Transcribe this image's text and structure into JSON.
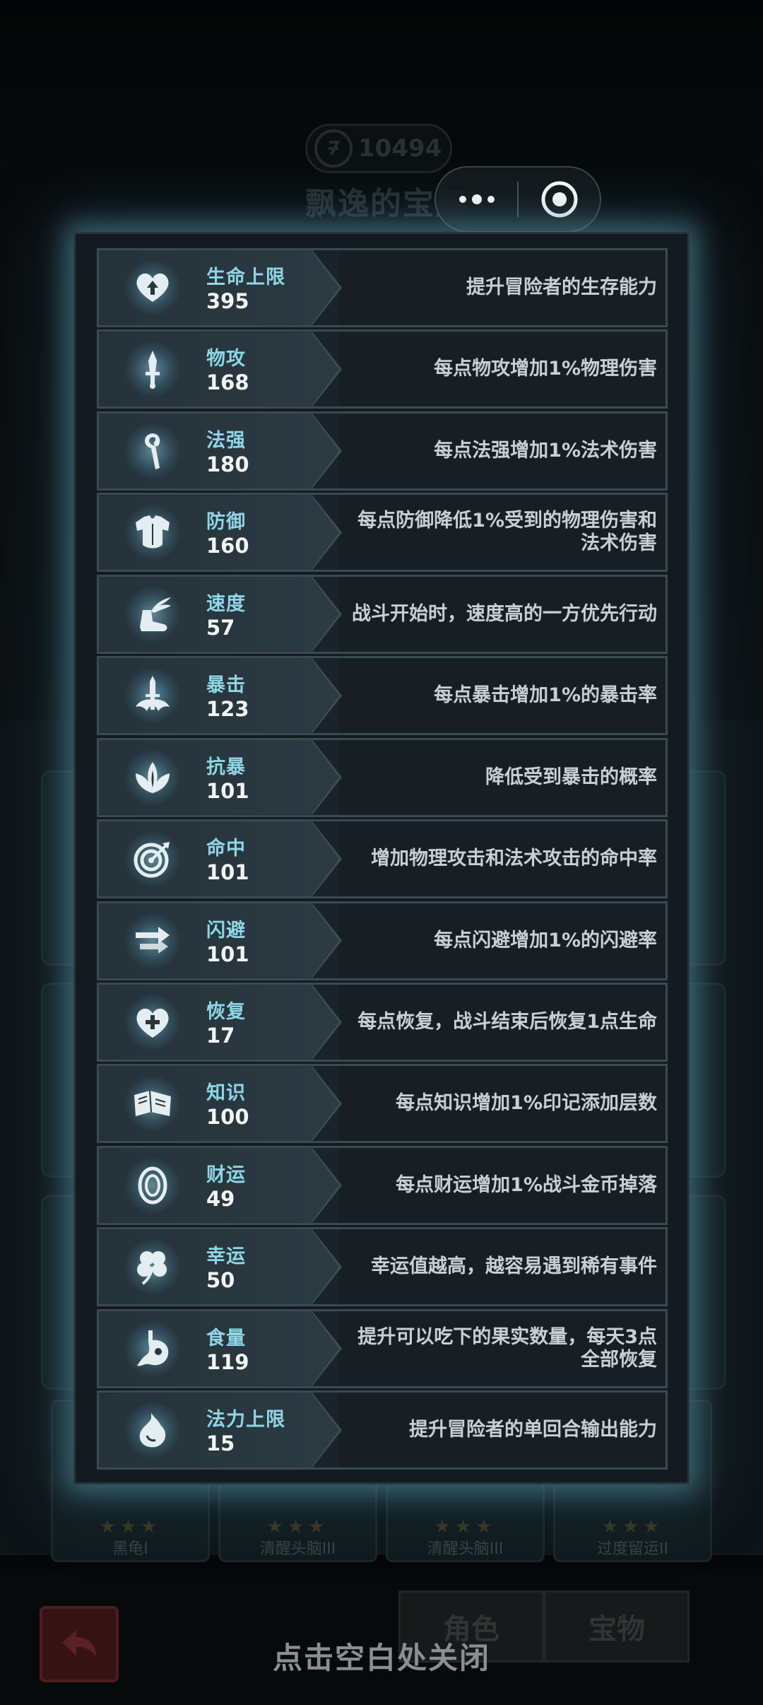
{
  "background": {
    "coins": "10494",
    "title": "飘逸的宝藏",
    "tabs": [
      "角色",
      "宝物"
    ],
    "cards": [
      {
        "name": "黑龟I",
        "stars": 3
      },
      {
        "name": "清醒头脑III",
        "stars": 3
      },
      {
        "name": "清醒头脑III",
        "stars": 3
      },
      {
        "name": "过度留运II",
        "stars": 3
      }
    ]
  },
  "capsule": {
    "more_icon": "more-dots-icon",
    "close_icon": "target-close-icon"
  },
  "stats": [
    {
      "name": "生命上限",
      "value": "395",
      "desc": "提升冒险者的生存能力",
      "icon": "heart-arrow-icon"
    },
    {
      "name": "物攻",
      "value": "168",
      "desc": "每点物攻增加1%物理伤害",
      "icon": "sword-icon"
    },
    {
      "name": "法强",
      "value": "180",
      "desc": "每点法强增加1%法术伤害",
      "icon": "staff-icon"
    },
    {
      "name": "防御",
      "value": "160",
      "desc": "每点防御降低1%受到的物理伤害和法术伤害",
      "icon": "armor-icon"
    },
    {
      "name": "速度",
      "value": "57",
      "desc": "战斗开始时，速度高的一方优先行动",
      "icon": "winged-boot-icon"
    },
    {
      "name": "暴击",
      "value": "123",
      "desc": "每点暴击增加1%的暴击率",
      "icon": "crit-dagger-icon"
    },
    {
      "name": "抗暴",
      "value": "101",
      "desc": "降低受到暴击的概率",
      "icon": "crit-resist-icon"
    },
    {
      "name": "命中",
      "value": "101",
      "desc": "增加物理攻击和法术攻击的命中率",
      "icon": "target-icon"
    },
    {
      "name": "闪避",
      "value": "101",
      "desc": "每点闪避增加1%的闪避率",
      "icon": "dodge-arrows-icon"
    },
    {
      "name": "恢复",
      "value": "17",
      "desc": "每点恢复，战斗结束后恢复1点生命",
      "icon": "heart-plus-icon"
    },
    {
      "name": "知识",
      "value": "100",
      "desc": "每点知识增加1%印记添加层数",
      "icon": "book-icon"
    },
    {
      "name": "财运",
      "value": "49",
      "desc": "每点财运增加1%战斗金币掉落",
      "icon": "coin-icon"
    },
    {
      "name": "幸运",
      "value": "50",
      "desc": "幸运值越高，越容易遇到稀有事件",
      "icon": "clover-icon"
    },
    {
      "name": "食量",
      "value": "119",
      "desc": "提升可以吃下的果实数量，每天3点全部恢复",
      "icon": "stomach-icon"
    },
    {
      "name": "法力上限",
      "value": "15",
      "desc": "提升冒险者的单回合输出能力",
      "icon": "mana-drop-icon"
    }
  ],
  "close_hint": "点击空白处关闭"
}
